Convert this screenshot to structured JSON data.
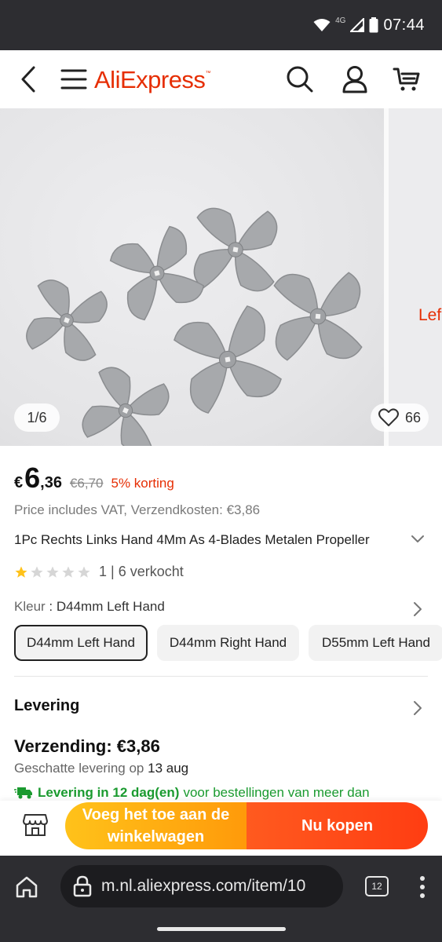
{
  "status_bar": {
    "time": "07:44",
    "network": "4G",
    "icons": [
      "wifi-icon",
      "signal-icon",
      "battery-icon"
    ]
  },
  "nav": {
    "back_icon": "chevron-left-icon",
    "menu_icon": "hamburger-icon",
    "logo": "AliExpress",
    "search_icon": "search-icon",
    "account_icon": "user-icon",
    "cart_icon": "cart-icon"
  },
  "gallery": {
    "counter": "1/6",
    "likes": "66",
    "next_image_text": "Lef"
  },
  "product": {
    "currency": "€",
    "price_int": "6",
    "price_dec": ",36",
    "old_price": "€6,70",
    "discount": "5% korting",
    "vat_line": "Price includes VAT, Verzendkosten: €3,86",
    "title": "1Pc Rechts Links Hand 4Mm As 4-Blades Metalen Propeller",
    "rating": 1,
    "rating_max": 5,
    "rating_text": "1 | 6 verkocht",
    "color_label": "Kleur",
    "color_value": "D44mm Left Hand",
    "variants": [
      "D44mm Left Hand",
      "D44mm Right Hand",
      "D55mm Left Hand"
    ],
    "selected_variant": 0
  },
  "delivery": {
    "title": "Levering",
    "shipping": "Verzending: €3,86",
    "estimate_prefix": "Geschatte levering op",
    "estimate_date": "13 aug",
    "promo_strong": "Levering in 12 dag(en)",
    "promo_rest": "voor bestellingen van meer dan"
  },
  "actions": {
    "store_icon": "store-icon",
    "add_to_cart": "Voeg het toe aan de winkelwagen",
    "buy_now": "Nu kopen"
  },
  "browser": {
    "home_icon": "home-icon",
    "lock_icon": "lock-icon",
    "url": "m.nl.aliexpress.com/item/10",
    "tab_count": "12",
    "menu_icon": "more-vert-icon"
  },
  "colors": {
    "brand": "#e62e04",
    "accent_orange": "#ff9a0a",
    "buy_red": "#ff3d12",
    "green": "#1a9a2f",
    "star": "#ffc21a"
  }
}
